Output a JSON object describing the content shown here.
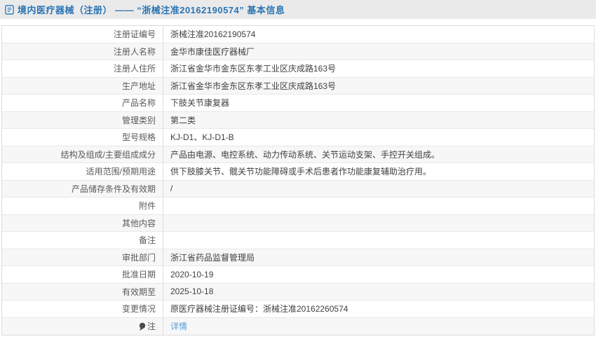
{
  "header": {
    "icon": "document-icon",
    "title": "境内医疗器械（注册） —— “浙械注准20162190574” 基本信息"
  },
  "colors": {
    "accent_blue": "#2a74b4",
    "link_blue": "#5a9bd5",
    "titlebar_bg": "#eaeaea",
    "stripe_bg": "#f7f7f7",
    "border": "#dcdcdc"
  },
  "table": {
    "rows": [
      {
        "label": "注册证编号",
        "value": "浙械注准20162190574"
      },
      {
        "label": "注册人名称",
        "value": "金华市康佳医疗器械厂"
      },
      {
        "label": "注册人住所",
        "value": "浙江省金华市金东区东孝工业区庆成路163号"
      },
      {
        "label": "生产地址",
        "value": "浙江省金华市金东区东孝工业区庆成路163号"
      },
      {
        "label": "产品名称",
        "value": "下肢关节康复器"
      },
      {
        "label": "管理类别",
        "value": "第二类"
      },
      {
        "label": "型号规格",
        "value": "KJ-D1、KJ-D1-B"
      },
      {
        "label": "结构及组成/主要组成成分",
        "value": "产品由电源、电控系统、动力传动系统、关节运动支架、手控开关组成。"
      },
      {
        "label": "适用范围/预期用途",
        "value": "供下肢膝关节、髋关节功能障碍或手术后患者作功能康复辅助治疗用。"
      },
      {
        "label": "产品储存条件及有效期",
        "value": "/"
      },
      {
        "label": "附件",
        "value": ""
      },
      {
        "label": "其他内容",
        "value": ""
      },
      {
        "label": "备注",
        "value": ""
      },
      {
        "label": "审批部门",
        "value": "浙江省药品监督管理局"
      },
      {
        "label": "批准日期",
        "value": "2020-10-19"
      },
      {
        "label": "有效期至",
        "value": "2025-10-18"
      },
      {
        "label": "变更情况",
        "value": "原医疗器械注册证编号：浙械注准20162260574"
      },
      {
        "label": "注",
        "icon": "note-pin-icon",
        "link": "详情"
      }
    ]
  }
}
